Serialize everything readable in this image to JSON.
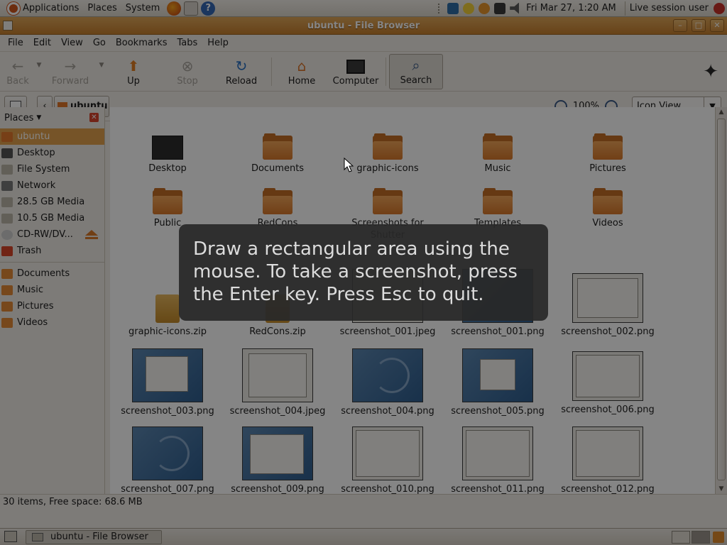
{
  "top_panel": {
    "menus": [
      "Applications",
      "Places",
      "System"
    ],
    "clock": "Fri Mar 27,  1:20 AM",
    "user": "Live session user"
  },
  "window": {
    "title": "ubuntu - File Browser",
    "min_glyph": "–",
    "max_glyph": "□",
    "close_glyph": "✕"
  },
  "menubar": [
    "File",
    "Edit",
    "View",
    "Go",
    "Bookmarks",
    "Tabs",
    "Help"
  ],
  "toolbar": {
    "back": "Back",
    "forward": "Forward",
    "up": "Up",
    "stop": "Stop",
    "reload": "Reload",
    "home": "Home",
    "computer": "Computer",
    "search": "Search"
  },
  "location": {
    "current": "ubuntu",
    "zoom": "100%",
    "view_mode": "Icon View"
  },
  "sidebar": {
    "header": "Places",
    "places": [
      "ubuntu",
      "Desktop",
      "File System",
      "Network",
      "28.5 GB Media",
      "10.5 GB Media",
      "CD-RW/DV...",
      "Trash"
    ],
    "bookmarks": [
      "Documents",
      "Music",
      "Pictures",
      "Videos"
    ]
  },
  "files": {
    "row1": [
      "Desktop",
      "Documents",
      "graphic-icons",
      "Music",
      "Pictures"
    ],
    "row2": [
      "Public",
      "RedCons",
      "Screenshots for Shutter",
      "Templates",
      "Videos"
    ],
    "row3": [
      "graphic-icons.zip",
      "RedCons.zip",
      "screenshot_001.jpeg",
      "screenshot_001.png",
      "screenshot_002.png"
    ],
    "row4": [
      "screenshot_003.png",
      "screenshot_004.jpeg",
      "screenshot_004.png",
      "screenshot_005.png",
      "screenshot_006.png"
    ],
    "row5": [
      "screenshot_007.png",
      "screenshot_009.png",
      "screenshot_010.png",
      "screenshot_011.png",
      "screenshot_012.png"
    ]
  },
  "status": "30 items, Free space: 68.6 MB",
  "taskbar": {
    "task": "ubuntu - File Browser"
  },
  "overlay": {
    "hint": "Draw a rectangular area using the mouse. To take a screenshot, press the Enter key. Press Esc to quit."
  },
  "colors": {
    "accent": "#e3a24d",
    "titlebar": "#c7802f",
    "folder": "#e58a36"
  }
}
